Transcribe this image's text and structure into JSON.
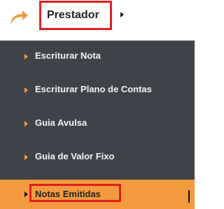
{
  "header": {
    "title": "Prestador",
    "icon": "redo-arrow-icon",
    "caret_icon": "submenu-caret-icon"
  },
  "menu": {
    "items": [
      {
        "label": "Escriturar Nota",
        "active": false
      },
      {
        "label": "Escriturar Plano de Contas",
        "active": false
      },
      {
        "label": "Guia Avulsa",
        "active": false
      },
      {
        "label": "Guia de Valor Fixo",
        "active": false
      },
      {
        "label": "Notas Emitidas",
        "active": true
      }
    ]
  },
  "colors": {
    "menu_background": "#3f4349",
    "active_background": "#f39a3e",
    "highlight_border": "#e11f1f",
    "bullet": "#f2a03a",
    "text_light": "#f3f4f6",
    "text_dark": "#1f2128"
  }
}
